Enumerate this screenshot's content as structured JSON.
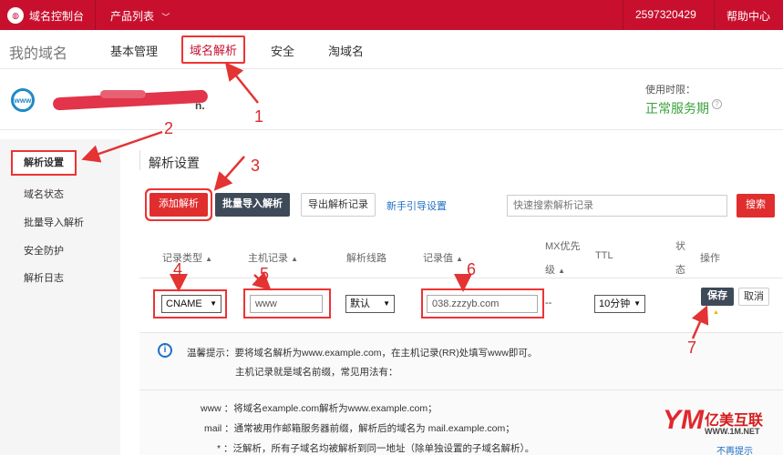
{
  "topbar": {
    "logo_text": "域名控制台",
    "logo_icon": "console-logo-icon",
    "products": "产品列表",
    "user_id": "2597320429",
    "help": "帮助中心"
  },
  "subnav": {
    "title": "我的域名",
    "tabs": [
      "基本管理",
      "域名解析",
      "安全",
      "淘域名"
    ]
  },
  "domain": {
    "name_visible": "n.",
    "service_label": "使用时限：",
    "service_status": "正常服务期"
  },
  "sidebar": {
    "items": [
      "解析设置",
      "域名状态",
      "批量导入解析",
      "安全防护",
      "解析日志"
    ]
  },
  "panel": {
    "title": "解析设置",
    "add": "添加解析",
    "batch": "批量导入解析",
    "export": "导出解析记录",
    "guide": "新手引导设置",
    "search_placeholder": "快速搜索解析记录",
    "search": "搜索"
  },
  "table": {
    "headers": {
      "type": "记录类型",
      "host": "主机记录",
      "line": "解析线路",
      "value": "记录值",
      "mx1": "MX优先",
      "mx2": "级",
      "ttl": "TTL",
      "status1": "状",
      "status2": "态",
      "ops": "操作"
    },
    "row": {
      "type": "CNAME",
      "host": "www",
      "line": "默认",
      "value": "038.zzzyb.com",
      "mx": "--",
      "ttl": "10分钟",
      "save": "保存",
      "cancel": "取消"
    }
  },
  "tips": {
    "line1": "温馨提示：要将域名解析为www.example.com，在主机记录(RR)处填写www即可。",
    "line2": "主机记录就是域名前缀，常见用法有：",
    "ex1": "www ：将域名example.com解析为www.example.com；",
    "ex2": "mail ：通常被用作邮箱服务器前缀，解析后的域名为 mail.example.com；",
    "ex3": "* ：泛解析，所有子域名均被解析到同一地址（除单独设置的子域名解析）。",
    "more": "不再提示"
  },
  "annotations": [
    "1",
    "2",
    "3",
    "4",
    "5",
    "6",
    "7"
  ],
  "watermark": {
    "mark": "YM",
    "name": "亿美互联",
    "url": "WWW.1M.NET"
  },
  "colors": {
    "brand_red": "#c8102e",
    "annotation_red": "#e33333",
    "button_dark": "#3e4a58",
    "status_green": "#3ca23c",
    "link_blue": "#1f6fc6"
  }
}
